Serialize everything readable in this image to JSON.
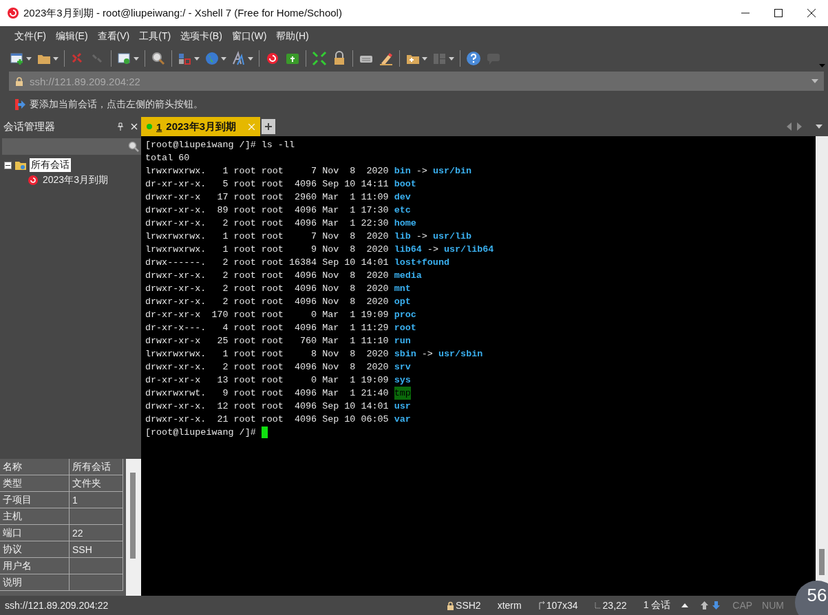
{
  "window": {
    "title": "2023年3月到期 - root@liupeiwang:/ - Xshell 7 (Free for Home/School)"
  },
  "menu": [
    {
      "label": "文件(F)"
    },
    {
      "label": "编辑(E)"
    },
    {
      "label": "查看(V)"
    },
    {
      "label": "工具(T)"
    },
    {
      "label": "选项卡(B)"
    },
    {
      "label": "窗口(W)"
    },
    {
      "label": "帮助(H)"
    }
  ],
  "address_bar": {
    "value": "ssh://121.89.209.204:22"
  },
  "info_bar": {
    "text": "要添加当前会话，点击左侧的箭头按钮。"
  },
  "session_manager": {
    "title": "会话管理器",
    "tree": [
      {
        "label": "所有会话",
        "selected": true,
        "expanded": true,
        "children": [
          {
            "label": "2023年3月到期",
            "selected": false
          }
        ]
      }
    ],
    "properties": [
      {
        "name": "名称",
        "value": "所有会话"
      },
      {
        "name": "类型",
        "value": "文件夹"
      },
      {
        "name": "子项目",
        "value": "1"
      },
      {
        "name": "主机"
      },
      {
        "name": "端口",
        "value": "22"
      },
      {
        "name": "协议",
        "value": "SSH"
      },
      {
        "name": "用户名"
      },
      {
        "name": "说明"
      }
    ]
  },
  "tabs": [
    {
      "number": "1",
      "label": "2023年3月到期",
      "selected": true,
      "connected": true
    }
  ],
  "terminal": {
    "lines": [
      {
        "kind": "text",
        "text": "[root@liupeiwang /]# ls -ll"
      },
      {
        "kind": "text",
        "text": "total 60"
      },
      {
        "kind": "link",
        "meta": "lrwxrwxrwx.   1 root root     7 Nov  8  2020",
        "name": "bin",
        "arrow": "->",
        "target": "usr/bin"
      },
      {
        "kind": "dir",
        "meta": "dr-xr-xr-x.   5 root root  4096 Sep 10 14:11",
        "name": "boot"
      },
      {
        "kind": "dir",
        "meta": "drwxr-xr-x   17 root root  2960 Mar  1 11:09",
        "name": "dev"
      },
      {
        "kind": "dir",
        "meta": "drwxr-xr-x.  89 root root  4096 Mar  1 17:30",
        "name": "etc"
      },
      {
        "kind": "dir",
        "meta": "drwxr-xr-x.   2 root root  4096 Mar  1 22:30",
        "name": "home"
      },
      {
        "kind": "link",
        "meta": "lrwxrwxrwx.   1 root root     7 Nov  8  2020",
        "name": "lib",
        "arrow": "->",
        "target": "usr/lib"
      },
      {
        "kind": "link",
        "meta": "lrwxrwxrwx.   1 root root     9 Nov  8  2020",
        "name": "lib64",
        "arrow": "->",
        "target": "usr/lib64"
      },
      {
        "kind": "dir",
        "meta": "drwx------.   2 root root 16384 Sep 10 14:01",
        "name": "lost+found"
      },
      {
        "kind": "dir",
        "meta": "drwxr-xr-x.   2 root root  4096 Nov  8  2020",
        "name": "media"
      },
      {
        "kind": "dir",
        "meta": "drwxr-xr-x.   2 root root  4096 Nov  8  2020",
        "name": "mnt"
      },
      {
        "kind": "dir",
        "meta": "drwxr-xr-x.   2 root root  4096 Nov  8  2020",
        "name": "opt"
      },
      {
        "kind": "dir",
        "meta": "dr-xr-xr-x  170 root root     0 Mar  1 19:09",
        "name": "proc"
      },
      {
        "kind": "dir",
        "meta": "dr-xr-x---.   4 root root  4096 Mar  1 11:29",
        "name": "root"
      },
      {
        "kind": "dir",
        "meta": "drwxr-xr-x   25 root root   760 Mar  1 11:10",
        "name": "run"
      },
      {
        "kind": "link",
        "meta": "lrwxrwxrwx.   1 root root     8 Nov  8  2020",
        "name": "sbin",
        "arrow": "->",
        "target": "usr/sbin"
      },
      {
        "kind": "dir",
        "meta": "drwxr-xr-x.   2 root root  4096 Nov  8  2020",
        "name": "srv"
      },
      {
        "kind": "dir",
        "meta": "dr-xr-xr-x   13 root root     0 Mar  1 19:09",
        "name": "sys"
      },
      {
        "kind": "sticky",
        "meta": "drwxrwxrwt.   9 root root  4096 Mar  1 21:40",
        "name": "tmp"
      },
      {
        "kind": "dir",
        "meta": "drwxr-xr-x.  12 root root  4096 Sep 10 14:01",
        "name": "usr"
      },
      {
        "kind": "dir",
        "meta": "drwxr-xr-x.  21 root root  4096 Sep 10 06:05",
        "name": "var"
      },
      {
        "kind": "prompt",
        "text": "[root@liupeiwang /]#"
      }
    ]
  },
  "status_bar": {
    "address": "ssh://121.89.209.204:22",
    "protocol": "SSH2",
    "terminal_type": "xterm",
    "size": "107x34",
    "cursor": "23,22",
    "sessions": "1 会话",
    "indicators": [
      {
        "label": "CAP",
        "on": false
      },
      {
        "label": "NUM",
        "on": false
      }
    ]
  },
  "overlay": {
    "text": "56"
  }
}
